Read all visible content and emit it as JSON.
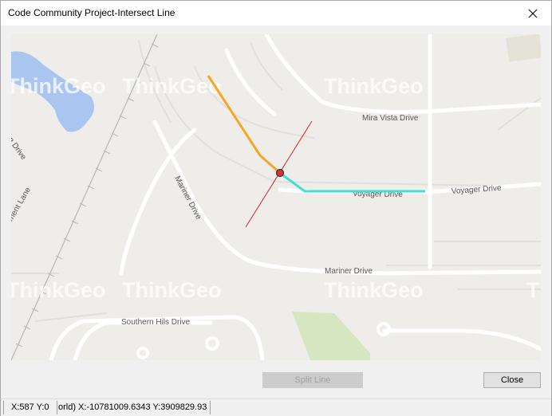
{
  "window": {
    "title": "Code Community Project-Intersect Line"
  },
  "map": {
    "watermark": "ThinkGeo",
    "streets": {
      "mira_vista": "Mira Vista Drive",
      "voyager_1": "Voyager Drive",
      "voyager_2": "Voyager Drive",
      "mariner_vertical": "Mariner Drive",
      "mariner_horizontal": "Mariner Drive",
      "southern_hills": "Southern Hils Drive",
      "edge_drive": "e Drive",
      "monument_lane": "ument Lane"
    },
    "colors": {
      "orange_line": "#f5a623",
      "teal_line": "#40e0d0",
      "red_line": "#e02020",
      "water": "#a9c5f0",
      "park": "#d6e6c1"
    }
  },
  "buttons": {
    "split": "Split Line",
    "close": "Close"
  },
  "status": {
    "screen": "X:587 Y:0",
    "world": "orld) X:-10781009.6343 Y:3909829.93"
  }
}
